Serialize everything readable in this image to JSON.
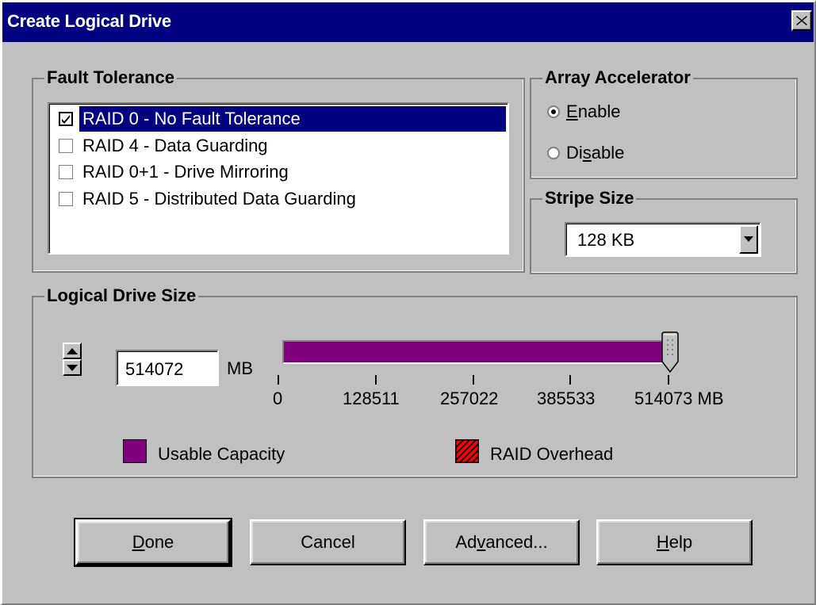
{
  "window": {
    "title": "Create Logical Drive"
  },
  "fault_tolerance": {
    "label": "Fault Tolerance",
    "options": [
      {
        "label": "RAID 0 - No Fault Tolerance",
        "checked": true,
        "selected": true
      },
      {
        "label": "RAID 4 - Data Guarding",
        "checked": false,
        "selected": false
      },
      {
        "label": "RAID 0+1 - Drive Mirroring",
        "checked": false,
        "selected": false
      },
      {
        "label": "RAID 5 - Distributed Data Guarding",
        "checked": false,
        "selected": false
      }
    ]
  },
  "array_accelerator": {
    "label": "Array Accelerator",
    "enable_pre": "",
    "enable_key": "E",
    "enable_post": "nable",
    "disable_pre": "Di",
    "disable_key": "s",
    "disable_post": "able",
    "selected": "Enable"
  },
  "stripe_size": {
    "label": "Stripe Size",
    "value": "128 KB"
  },
  "logical_drive_size": {
    "label": "Logical Drive Size",
    "value": "514072",
    "unit": "MB",
    "usable_fraction": 1.0,
    "ticks": [
      "0",
      "128511",
      "257022",
      "385533",
      "514073 MB"
    ],
    "legend": {
      "usable": "Usable Capacity",
      "overhead": "RAID Overhead"
    },
    "colors": {
      "usable": "#800080",
      "overhead": "#ff0000"
    }
  },
  "buttons": {
    "done_key": "D",
    "done_rest": "one",
    "cancel": "Cancel",
    "advanced_pre": "Ad",
    "advanced_key": "v",
    "advanced_post": "anced...",
    "help_key": "H",
    "help_rest": "elp"
  }
}
